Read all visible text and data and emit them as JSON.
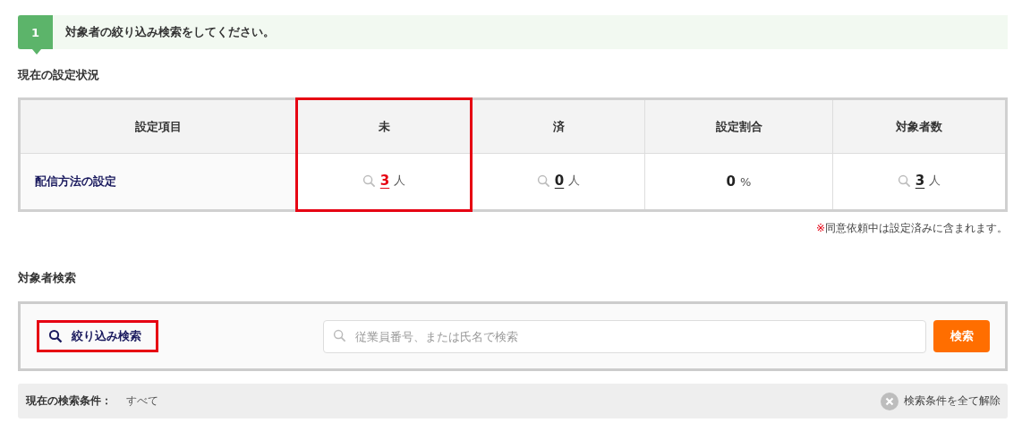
{
  "step": {
    "number": "1",
    "text": "対象者の絞り込み検索をしてください。"
  },
  "status_section": {
    "heading": "現在の設定状況",
    "columns": [
      {
        "label": "設定項目",
        "highlighted": false
      },
      {
        "label": "未",
        "highlighted": true
      },
      {
        "label": "済",
        "highlighted": false
      },
      {
        "label": "設定割合",
        "highlighted": false
      },
      {
        "label": "対象者数",
        "highlighted": false
      }
    ],
    "rows": [
      {
        "cells": [
          {
            "kind": "label",
            "value": "配信方法の設定"
          },
          {
            "kind": "link",
            "value": "3",
            "unit": "人",
            "alert": true
          },
          {
            "kind": "link",
            "value": "0",
            "unit": "人",
            "alert": false
          },
          {
            "kind": "plain",
            "value": "0",
            "unit": "%",
            "alert": false
          },
          {
            "kind": "link",
            "value": "3",
            "unit": "人",
            "alert": false
          }
        ]
      }
    ],
    "note_mark": "※",
    "note": "同意依頼中は設定済みに含まれます。"
  },
  "search_section": {
    "heading": "対象者検索",
    "filter_button": {
      "label": "絞り込み検索",
      "highlighted": true
    },
    "search_field": {
      "placeholder": "従業員番号、または氏名で検索"
    },
    "search_button": "検索",
    "condition_label": "現在の検索条件：",
    "condition_value": "すべて",
    "clear_button": "検索条件を全て解除"
  }
}
